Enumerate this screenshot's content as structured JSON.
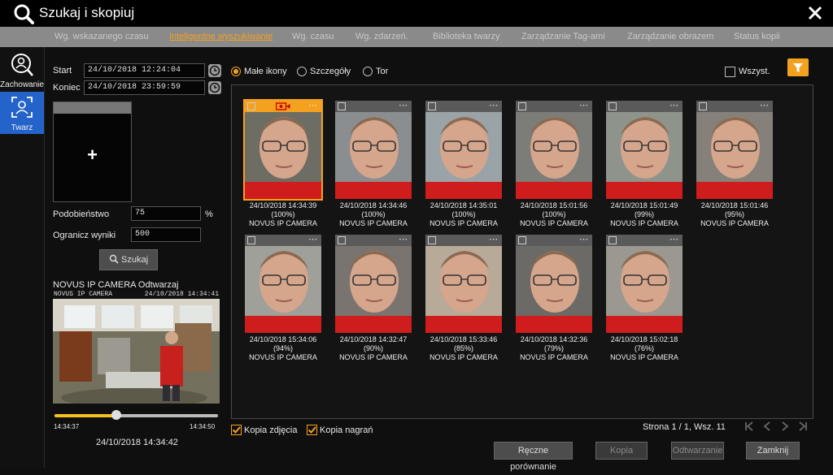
{
  "window": {
    "title": "Szukaj i skopiuj"
  },
  "tabs": [
    {
      "label": "Wg. wskazanego czasu",
      "active": false
    },
    {
      "label": "Inteligentne wyszukiwanie",
      "active": true
    },
    {
      "label": "Wg. czasu",
      "active": false
    },
    {
      "label": "Wg. zdarzeń.",
      "active": false
    },
    {
      "label": "Biblioteka twarzy",
      "active": false
    },
    {
      "label": "Zarządzanie Tag-ami",
      "active": false
    },
    {
      "label": "Zarządzanie obrazem",
      "active": false
    },
    {
      "label": "Status kopii",
      "active": false
    }
  ],
  "sidebar": {
    "items": [
      {
        "label": "Zachowanie",
        "icon": "behavior-search-icon",
        "active": false
      },
      {
        "label": "Twarz",
        "icon": "face-icon",
        "active": true
      }
    ]
  },
  "search_form": {
    "start_label": "Start",
    "start_value": "24/10/2018 12:24:04",
    "end_label": "Koniec",
    "end_value": "24/10/2018 23:59:59",
    "add_face_symbol": "+",
    "similarity_label": "Podobieństwo",
    "similarity_value": "75",
    "similarity_unit": "%",
    "limit_label": "Ogranicz wyniki",
    "limit_value": "500",
    "search_button": "Szukaj"
  },
  "player": {
    "title": "NOVUS IP CAMERA Odtwarzaj",
    "overlay_camera": "NOVUS IP CAMERA",
    "overlay_time": "24/10/2018 14:34:41",
    "time_start": "14:34:37",
    "time_end": "14:34:50",
    "progress": 0.38,
    "current_time": "24/10/2018 14:34:42"
  },
  "view_options": {
    "small_icons": "Małe ikony",
    "details": "Szczegóły",
    "track": "Tor",
    "selected": "small_icons",
    "select_all": "Wszyst.",
    "filter_icon": "filter-icon"
  },
  "results": [
    {
      "time": "24/10/2018 14:34:39",
      "score": "(100%)",
      "camera": "NOVUS IP CAMERA",
      "selected": true
    },
    {
      "time": "24/10/2018 14:34:46",
      "score": "(100%)",
      "camera": "NOVUS IP CAMERA",
      "selected": false
    },
    {
      "time": "24/10/2018 14:35:01",
      "score": "(100%)",
      "camera": "NOVUS IP CAMERA",
      "selected": false
    },
    {
      "time": "24/10/2018 15:01:56",
      "score": "(100%)",
      "camera": "NOVUS IP CAMERA",
      "selected": false
    },
    {
      "time": "24/10/2018 15:01:49",
      "score": "(99%)",
      "camera": "NOVUS IP CAMERA",
      "selected": false
    },
    {
      "time": "24/10/2018 15:01:46",
      "score": "(95%)",
      "camera": "NOVUS IP CAMERA",
      "selected": false
    },
    {
      "time": "24/10/2018 15:34:06",
      "score": "(94%)",
      "camera": "NOVUS IP CAMERA",
      "selected": false
    },
    {
      "time": "24/10/2018 14:32:47",
      "score": "(90%)",
      "camera": "NOVUS IP CAMERA",
      "selected": false
    },
    {
      "time": "24/10/2018 15:33:46",
      "score": "(85%)",
      "camera": "NOVUS IP CAMERA",
      "selected": false
    },
    {
      "time": "24/10/2018 14:32:36",
      "score": "(79%)",
      "camera": "NOVUS IP CAMERA",
      "selected": false
    },
    {
      "time": "24/10/2018 15:02:18",
      "score": "(76%)",
      "camera": "NOVUS IP CAMERA",
      "selected": false
    }
  ],
  "footer": {
    "copy_picture": "Kopia zdjęcia",
    "copy_recording": "Kopia nagrań",
    "pager_text": "Strona 1 / 1, Wsz. 11",
    "manual_compare": "Ręczne porównanie",
    "copy_button": "Kopia",
    "play_button": "Odtwarzanie",
    "close_button": "Zamknij"
  },
  "colors": {
    "accent": "#f4a11f",
    "active_blue": "#2463c9",
    "tab_bar": "#8a8a8a"
  }
}
